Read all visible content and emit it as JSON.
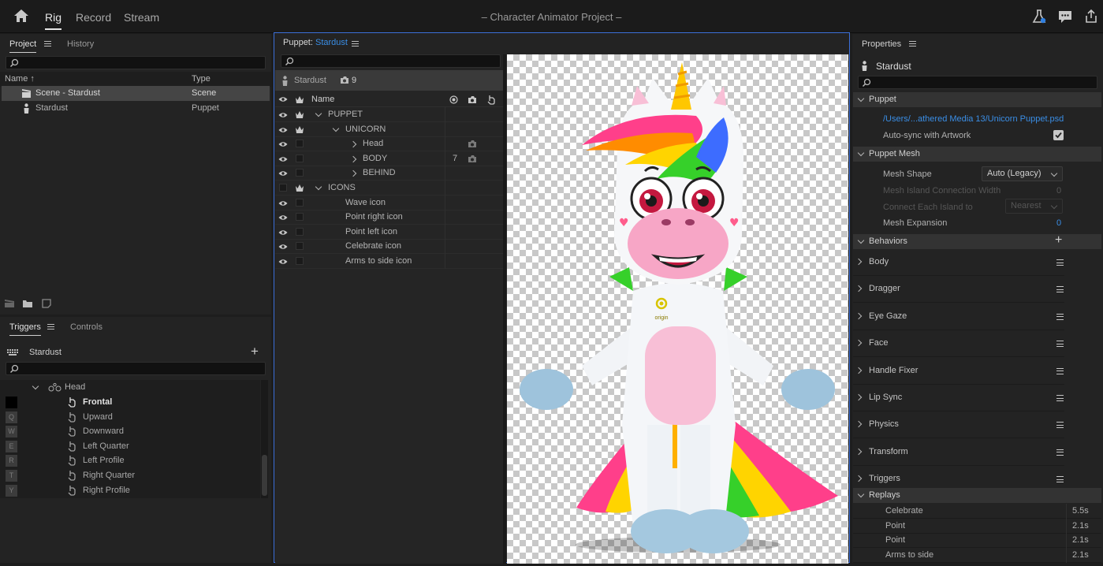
{
  "topbar": {
    "workspaces": [
      "Rig",
      "Record",
      "Stream"
    ],
    "active_workspace": "Rig",
    "title": "– Character Animator Project –",
    "icons": [
      "home-icon",
      "flask-icon",
      "chat-icon",
      "share-icon"
    ]
  },
  "project_panel": {
    "tabs": [
      "Project",
      "History"
    ],
    "columns": [
      "Name",
      "Type"
    ],
    "items": [
      {
        "name": "Scene - Stardust",
        "type": "Scene",
        "icon": "scene-icon",
        "selected": true
      },
      {
        "name": "Stardust",
        "type": "Puppet",
        "icon": "puppet-icon",
        "selected": false
      }
    ]
  },
  "triggers_panel": {
    "tabs": [
      "Triggers",
      "Controls"
    ],
    "puppet": "Stardust",
    "group": "Head",
    "items": [
      {
        "key": "",
        "label": "Frontal",
        "active": true
      },
      {
        "key": "Q",
        "label": "Upward"
      },
      {
        "key": "W",
        "label": "Downward"
      },
      {
        "key": "E",
        "label": "Left Quarter"
      },
      {
        "key": "R",
        "label": "Left Profile"
      },
      {
        "key": "T",
        "label": "Right Quarter"
      },
      {
        "key": "Y",
        "label": "Right Profile"
      }
    ]
  },
  "puppet_panel": {
    "title_prefix": "Puppet:",
    "title_name": "Stardust",
    "puppet_name": "Stardust",
    "camera_count": "9",
    "column_name": "Name",
    "layers": [
      {
        "name": "PUPPET",
        "indent": 0,
        "expanded": true,
        "crown": true,
        "eye": true,
        "count": ""
      },
      {
        "name": "UNICORN",
        "indent": 1,
        "expanded": true,
        "crown": true,
        "eye": true,
        "count": ""
      },
      {
        "name": "Head",
        "indent": 2,
        "expanded": false,
        "crown": false,
        "eye": true,
        "count": "",
        "camera": true
      },
      {
        "name": "BODY",
        "indent": 2,
        "expanded": false,
        "crown": false,
        "eye": true,
        "count": "7",
        "camera": true
      },
      {
        "name": "BEHIND",
        "indent": 2,
        "expanded": false,
        "crown": false,
        "eye": true,
        "count": ""
      },
      {
        "name": "ICONS",
        "indent": 0,
        "expanded": true,
        "crown": true,
        "eye": false,
        "count": ""
      },
      {
        "name": "Wave icon",
        "indent": 1,
        "leaf": true,
        "crown": false,
        "eye": true,
        "count": ""
      },
      {
        "name": "Point right icon",
        "indent": 1,
        "leaf": true,
        "crown": false,
        "eye": true,
        "count": ""
      },
      {
        "name": "Point left icon",
        "indent": 1,
        "leaf": true,
        "crown": false,
        "eye": true,
        "count": ""
      },
      {
        "name": "Celebrate icon",
        "indent": 1,
        "leaf": true,
        "crown": false,
        "eye": true,
        "count": ""
      },
      {
        "name": "Arms to side icon",
        "indent": 1,
        "leaf": true,
        "crown": false,
        "eye": true,
        "count": ""
      }
    ],
    "origin_label": "origin"
  },
  "properties_panel": {
    "title": "Properties",
    "puppet_name": "Stardust",
    "puppet_section": "Puppet",
    "psd_path": "/Users/...athered Media 13/Unicorn Puppet.psd",
    "auto_sync_label": "Auto-sync with Artwork",
    "auto_sync_checked": true,
    "mesh_section": "Puppet Mesh",
    "mesh_shape_label": "Mesh Shape",
    "mesh_shape_value": "Auto (Legacy)",
    "island_width_label": "Mesh Island Connection Width",
    "island_width_value": "0",
    "connect_label": "Connect Each Island to",
    "connect_value": "Nearest",
    "expansion_label": "Mesh Expansion",
    "expansion_value": "0",
    "behaviors_section": "Behaviors",
    "behaviors": [
      "Body",
      "Dragger",
      "Eye Gaze",
      "Face",
      "Handle Fixer",
      "Lip Sync",
      "Physics",
      "Transform",
      "Triggers"
    ],
    "replays_section": "Replays",
    "replays": [
      {
        "name": "Celebrate",
        "duration": "5.5s"
      },
      {
        "name": "Point",
        "duration": "2.1s"
      },
      {
        "name": "Point",
        "duration": "2.1s"
      },
      {
        "name": "Arms to side",
        "duration": "2.1s"
      }
    ]
  }
}
